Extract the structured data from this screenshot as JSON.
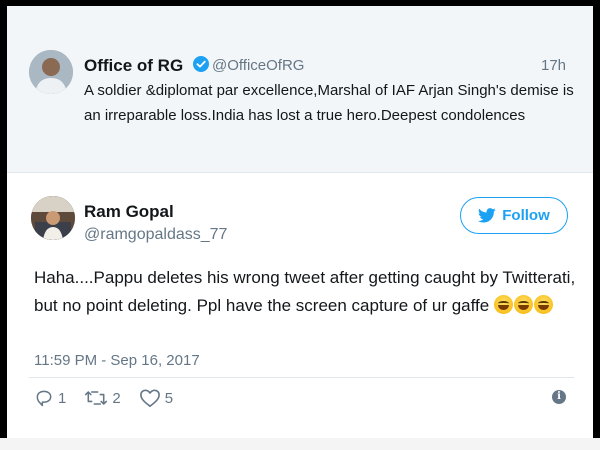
{
  "quoted_tweet": {
    "name": "Office of RG",
    "handle": "@OfficeOfRG",
    "time": "17h",
    "text": "A soldier &diplomat par excellence,Marshal of IAF Arjan Singh's demise is an irreparable loss.India has lost a true hero.Deepest condolences",
    "verified": true
  },
  "main_tweet": {
    "name": "Ram Gopal",
    "handle": "@ramgopaldass_77",
    "follow_label": "Follow",
    "text": "Haha....Pappu deletes his wrong tweet after getting caught by Twitterati, but no point deleting. Ppl have the screen capture of ur gaffe",
    "emoji_count": 3,
    "timestamp": "11:59 PM - Sep 16, 2017"
  },
  "actions": {
    "replies": "1",
    "retweets": "2",
    "likes": "5"
  },
  "icons": [
    "verified-badge-icon",
    "twitter-bird-icon",
    "reply-icon",
    "retweet-icon",
    "heart-icon",
    "info-icon"
  ],
  "colors": {
    "accent": "#1da1f2",
    "secondary_text": "#657786",
    "quoted_bg": "#f3f6f8"
  }
}
